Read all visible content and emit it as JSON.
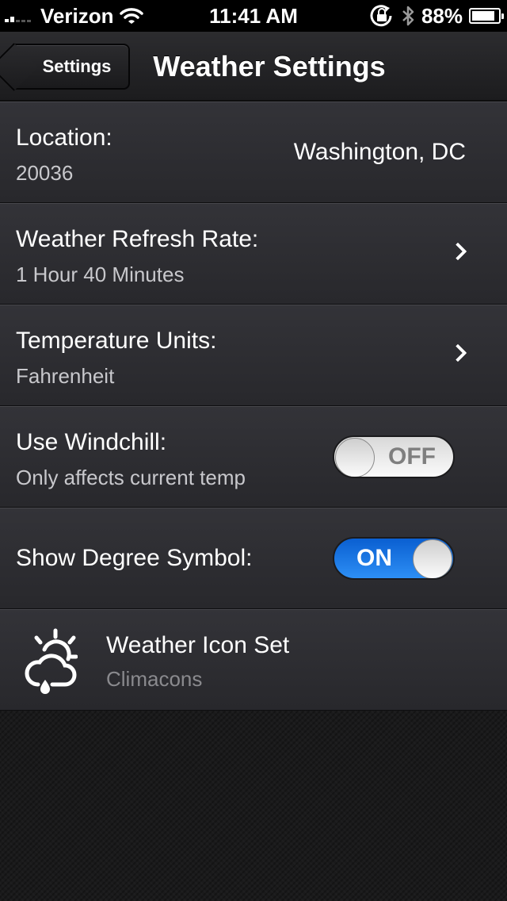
{
  "status_bar": {
    "carrier": "Verizon",
    "time": "11:41 AM",
    "battery": "88%",
    "battery_level": 0.88,
    "signal_icon": "signal-bars-icon",
    "wifi_icon": "wifi-icon",
    "rotation_lock_icon": "rotation-lock-icon",
    "bluetooth_icon": "bluetooth-icon"
  },
  "nav": {
    "back_label": "Settings",
    "title": "Weather Settings"
  },
  "rows": {
    "location": {
      "title": "Location:",
      "subtitle": "20036",
      "value": "Washington, DC"
    },
    "refresh": {
      "title": "Weather Refresh Rate:",
      "subtitle": "1 Hour 40 Minutes"
    },
    "units": {
      "title": "Temperature Units:",
      "subtitle": "Fahrenheit"
    },
    "windchill": {
      "title": "Use Windchill:",
      "subtitle": "Only affects current temp",
      "toggle_label": "OFF",
      "state": false
    },
    "degree": {
      "title": "Show Degree Symbol:",
      "toggle_label": "ON",
      "state": true
    },
    "icon_set": {
      "title": "Weather Icon Set",
      "subtitle": "Climacons",
      "icon": "climacon-cloud-sun-rain-icon"
    }
  },
  "colors": {
    "toggle_on": "#1a78e8",
    "row_background": "#2e2e32",
    "background": "#1a1a1b"
  }
}
